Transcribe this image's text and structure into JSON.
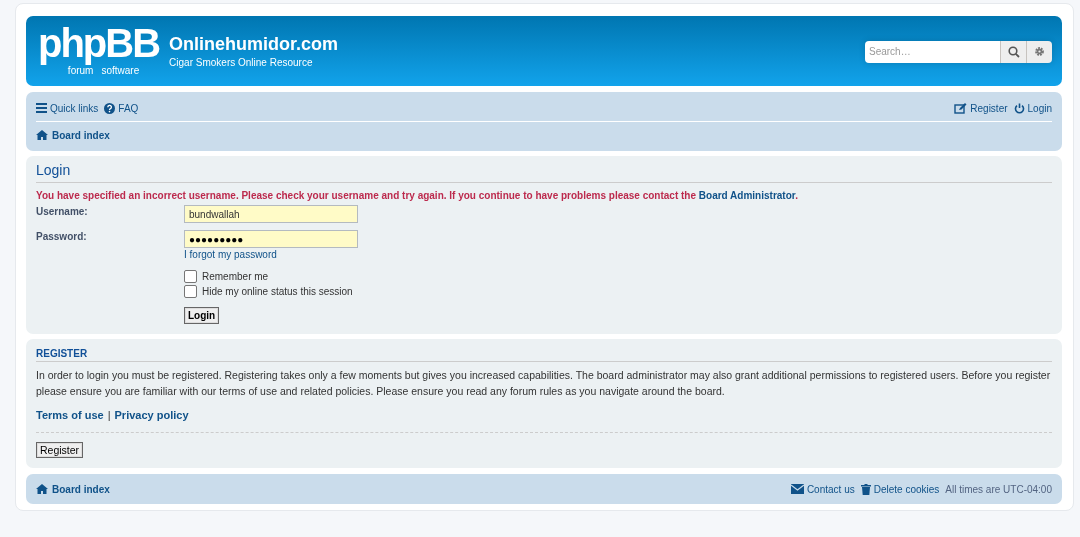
{
  "header": {
    "logo": "phpBB",
    "logo_sub_left": "forum",
    "logo_sub_right": "software",
    "site_title": "Onlinehumidor.com",
    "site_description": "Cigar Smokers Online Resource",
    "search": {
      "placeholder": "Search…"
    }
  },
  "navbar": {
    "left": [
      {
        "kind": "menu",
        "label": "Quick links"
      },
      {
        "kind": "help",
        "label": "FAQ"
      }
    ],
    "right": [
      {
        "kind": "edit",
        "label": "Register"
      },
      {
        "kind": "power",
        "label": "Login"
      }
    ],
    "breadcrumb": "Board index"
  },
  "login": {
    "title": "Login",
    "error": {
      "text": "You have specified an incorrect username. Please check your username and try again. If you continue to have problems please contact the",
      "link": "Board Administrator",
      "end": "."
    },
    "fields": [
      {
        "label": "Username:",
        "value": "bundwallah"
      },
      {
        "label": "Password:",
        "value": "●●●●●●●●●"
      }
    ],
    "forgot": "I forgot my password",
    "options": [
      {
        "label": "Remember me",
        "checked": false
      },
      {
        "label": "Hide my online status this session",
        "checked": false
      }
    ],
    "button": "Login"
  },
  "register": {
    "title": "REGISTER",
    "text": "In order to login you must be registered. Registering takes only a few moments but gives you increased capabilities. The board administrator may also grant additional permissions to registered users. Before you register please ensure you are familiar with our terms of use and related policies. Please ensure you read any forum rules as you navigate around the board.",
    "links": [
      "Terms of use",
      "Privacy policy"
    ],
    "separator": "|",
    "button": "Register"
  },
  "footer": {
    "breadcrumb": "Board index",
    "links": [
      {
        "kind": "mail",
        "label": "Contact us"
      },
      {
        "kind": "trash",
        "label": "Delete cookies"
      }
    ],
    "timezone": "All times are UTC-04:00"
  }
}
